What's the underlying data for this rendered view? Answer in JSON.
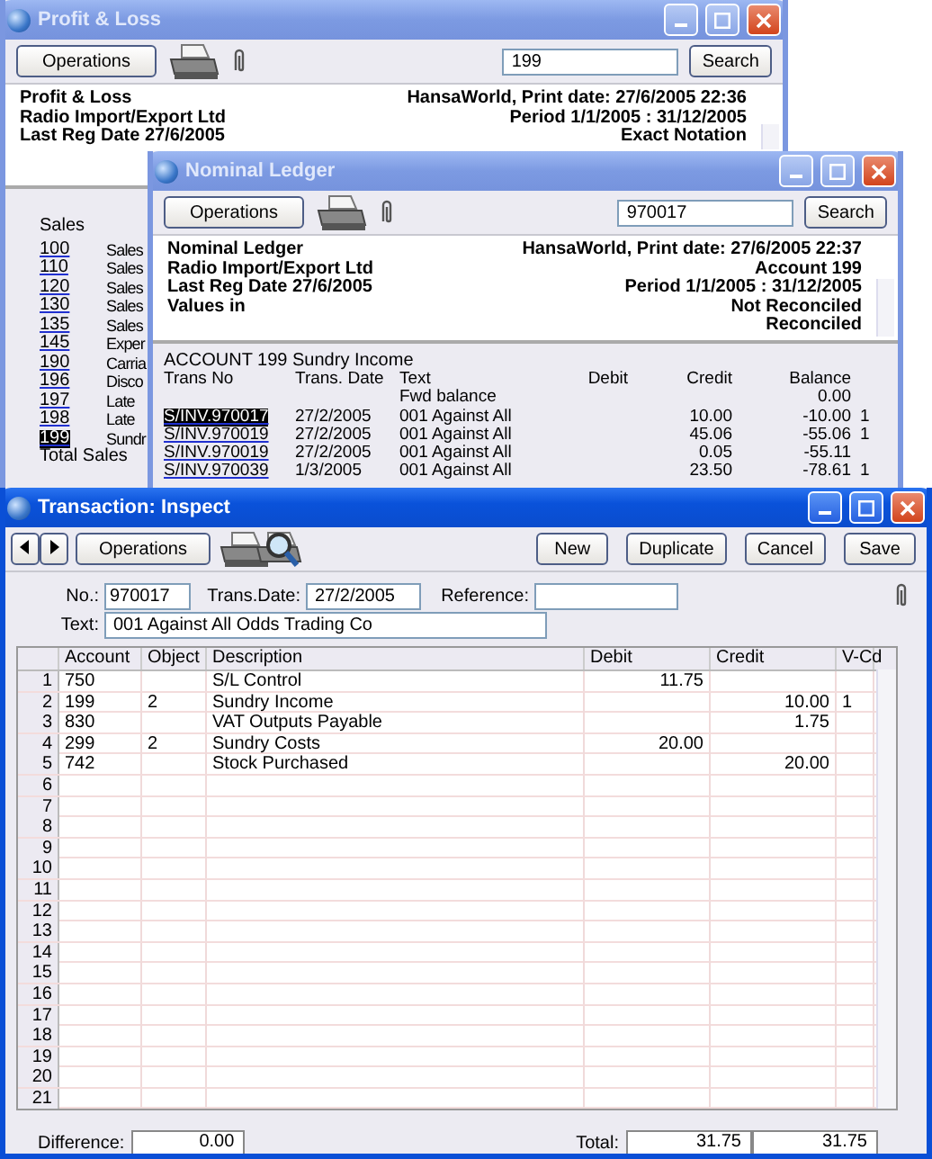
{
  "profit_loss": {
    "title": "Profit & Loss",
    "active": false,
    "operations": "Operations",
    "search_value": "199",
    "search_button": "Search",
    "header_left": [
      "Profit & Loss",
      "Radio Import/Export Ltd",
      "Last Reg Date  27/6/2005"
    ],
    "header_right": [
      "HansaWorld, Print date: 27/6/2005 22:36",
      "Period  1/1/2005 : 31/12/2005",
      "Exact Notation"
    ],
    "section": "Sales",
    "rows": [
      {
        "account": "100",
        "name": "Sales",
        "selected": false
      },
      {
        "account": "110",
        "name": "Sales",
        "selected": false
      },
      {
        "account": "120",
        "name": "Sales",
        "selected": false
      },
      {
        "account": "130",
        "name": "Sales",
        "selected": false
      },
      {
        "account": "135",
        "name": "Sales",
        "selected": false
      },
      {
        "account": "145",
        "name": "Exper",
        "selected": false
      },
      {
        "account": "190",
        "name": "Carria",
        "selected": false
      },
      {
        "account": "196",
        "name": "Disco",
        "selected": false
      },
      {
        "account": "197",
        "name": "Late",
        "selected": false
      },
      {
        "account": "198",
        "name": "Late",
        "selected": false
      },
      {
        "account": "199",
        "name": "Sundr",
        "selected": true
      }
    ],
    "total": "Total Sales"
  },
  "nominal_ledger": {
    "title": "Nominal Ledger",
    "active": false,
    "operations": "Operations",
    "search_value": "970017",
    "search_button": "Search",
    "header_left": [
      "Nominal Ledger",
      "Radio Import/Export Ltd",
      "Last Reg Date  27/6/2005",
      "Values in"
    ],
    "header_right": [
      "HansaWorld, Print date: 27/6/2005 22:37",
      "Account  199",
      "Period  1/1/2005 : 31/12/2005",
      "Not Reconciled",
      "Reconciled"
    ],
    "account_line": "ACCOUNT 199  Sundry Income",
    "columns": [
      "Trans No",
      "Trans. Date",
      "Text",
      "Debit",
      "Credit",
      "Balance"
    ],
    "fwd": {
      "text": "Fwd balance",
      "balance": "0.00"
    },
    "rows": [
      {
        "trans_no": "S/INV.970017",
        "date": "27/2/2005",
        "text": "001 Against All",
        "credit": "10.00",
        "balance": "-10.00",
        "flag": "1",
        "selected": true
      },
      {
        "trans_no": "S/INV.970019",
        "date": "27/2/2005",
        "text": "001 Against All",
        "credit": "45.06",
        "balance": "-55.06",
        "flag": "1",
        "selected": false
      },
      {
        "trans_no": "S/INV.970019",
        "date": "27/2/2005",
        "text": "001 Against All",
        "credit": "0.05",
        "balance": "-55.11",
        "selected": false
      },
      {
        "trans_no": "S/INV.970039",
        "date": "1/3/2005",
        "text": "001 Against All",
        "credit": "23.50",
        "balance": "-78.61",
        "flag": "1",
        "selected": false
      }
    ]
  },
  "transaction": {
    "title": "Transaction: Inspect",
    "active": true,
    "operations": "Operations",
    "buttons": [
      "New",
      "Duplicate",
      "Cancel",
      "Save"
    ],
    "no_label": "No.:",
    "no": "970017",
    "date_label": "Trans.Date:",
    "date": "27/2/2005",
    "reference_label": "Reference:",
    "text_label": "Text:",
    "text": "001 Against All Odds Trading Co",
    "columns": [
      "Account",
      "Object",
      "Description",
      "Debit",
      "Credit",
      "V-Cd"
    ],
    "rows": [
      {
        "num": "1",
        "account": "750",
        "description": "S/L Control",
        "debit": "11.75"
      },
      {
        "num": "2",
        "account": "199",
        "object": "2",
        "description": "Sundry Income",
        "credit": "10.00",
        "vcd": "1"
      },
      {
        "num": "3",
        "account": "830",
        "description": "VAT Outputs Payable",
        "credit": "1.75"
      },
      {
        "num": "4",
        "account": "299",
        "object": "2",
        "description": "Sundry Costs",
        "debit": "20.00"
      },
      {
        "num": "5",
        "account": "742",
        "description": "Stock Purchased",
        "credit": "20.00"
      },
      {
        "num": "6"
      },
      {
        "num": "7"
      },
      {
        "num": "8"
      },
      {
        "num": "9"
      },
      {
        "num": "10"
      },
      {
        "num": "11"
      },
      {
        "num": "12"
      },
      {
        "num": "13"
      },
      {
        "num": "14"
      },
      {
        "num": "15"
      },
      {
        "num": "16"
      },
      {
        "num": "17"
      },
      {
        "num": "18"
      },
      {
        "num": "19"
      },
      {
        "num": "20"
      },
      {
        "num": "21"
      }
    ],
    "difference_label": "Difference:",
    "difference": "0.00",
    "total_label": "Total:",
    "total_debit": "31.75",
    "total_credit": "31.75"
  }
}
